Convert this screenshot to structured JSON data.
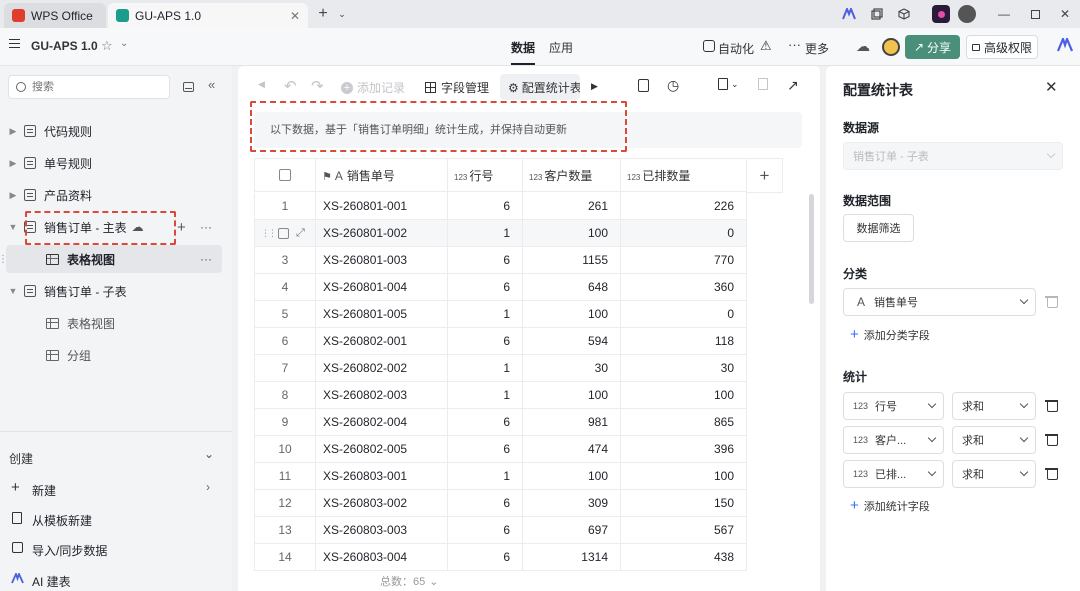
{
  "window": {
    "tabs": [
      {
        "label": "WPS Office"
      },
      {
        "label": "GU-APS 1.0"
      }
    ],
    "new_tab": "+"
  },
  "header": {
    "app_name": "GU-APS 1.0",
    "nav_tabs": [
      {
        "label": "数据",
        "active": true
      },
      {
        "label": "应用",
        "active": false
      }
    ],
    "automation": "自动化",
    "more": "更多",
    "share": "分享",
    "advanced_permission": "高级权限"
  },
  "sidebar": {
    "search_placeholder": "搜索",
    "items": [
      {
        "label": "代码规则"
      },
      {
        "label": "单号规则"
      },
      {
        "label": "产品资料"
      },
      {
        "label": "销售订单 - 主表"
      },
      {
        "label": "表格视图",
        "active": true
      },
      {
        "label": "销售订单 - 子表"
      },
      {
        "label": "表格视图"
      },
      {
        "label": "分组"
      }
    ],
    "create_section": "创建",
    "create_items": [
      {
        "label": "新建"
      },
      {
        "label": "从模板新建"
      },
      {
        "label": "导入/同步数据"
      },
      {
        "label": "AI 建表"
      }
    ]
  },
  "toolbar": {
    "add_record": "添加记录",
    "field_manage": "字段管理",
    "config_stats": "配置统计表"
  },
  "banner": "以下数据，基于「销售订单明细」统计生成，并保持自动更新",
  "table": {
    "columns": [
      {
        "label": "销售单号"
      },
      {
        "label": "行号"
      },
      {
        "label": "客户数量"
      },
      {
        "label": "已排数量"
      }
    ],
    "rows": [
      {
        "n": "1",
        "order": "XS-260801-001",
        "line": "6",
        "qty": "261",
        "scheduled": "226"
      },
      {
        "n": "2",
        "order": "XS-260801-002",
        "line": "1",
        "qty": "100",
        "scheduled": "0"
      },
      {
        "n": "3",
        "order": "XS-260801-003",
        "line": "6",
        "qty": "1155",
        "scheduled": "770"
      },
      {
        "n": "4",
        "order": "XS-260801-004",
        "line": "6",
        "qty": "648",
        "scheduled": "360"
      },
      {
        "n": "5",
        "order": "XS-260801-005",
        "line": "1",
        "qty": "100",
        "scheduled": "0"
      },
      {
        "n": "6",
        "order": "XS-260802-001",
        "line": "6",
        "qty": "594",
        "scheduled": "118"
      },
      {
        "n": "7",
        "order": "XS-260802-002",
        "line": "1",
        "qty": "30",
        "scheduled": "30"
      },
      {
        "n": "8",
        "order": "XS-260802-003",
        "line": "1",
        "qty": "100",
        "scheduled": "100"
      },
      {
        "n": "9",
        "order": "XS-260802-004",
        "line": "6",
        "qty": "981",
        "scheduled": "865"
      },
      {
        "n": "10",
        "order": "XS-260802-005",
        "line": "6",
        "qty": "474",
        "scheduled": "396"
      },
      {
        "n": "11",
        "order": "XS-260803-001",
        "line": "1",
        "qty": "100",
        "scheduled": "100"
      },
      {
        "n": "12",
        "order": "XS-260803-002",
        "line": "6",
        "qty": "309",
        "scheduled": "150"
      },
      {
        "n": "13",
        "order": "XS-260803-003",
        "line": "6",
        "qty": "697",
        "scheduled": "567"
      },
      {
        "n": "14",
        "order": "XS-260803-004",
        "line": "6",
        "qty": "1314",
        "scheduled": "438"
      }
    ],
    "total": "总数：65"
  },
  "panel": {
    "title": "配置统计表",
    "data_source_label": "数据源",
    "data_source_value": "销售订单 - 子表",
    "data_range_label": "数据范围",
    "data_filter": "数据筛选",
    "group_label": "分类",
    "group_field": "销售单号",
    "add_group_field": "添加分类字段",
    "stats_label": "统计",
    "stats": [
      {
        "field": "行号",
        "agg": "求和"
      },
      {
        "field": "客户...",
        "agg": "求和"
      },
      {
        "field": "已排...",
        "agg": "求和"
      }
    ],
    "add_stat_field": "添加统计字段"
  },
  "colors": {
    "accent": "#3370ff",
    "share_button": "#4a8f7a",
    "highlight_dash": "#d94a3a"
  }
}
